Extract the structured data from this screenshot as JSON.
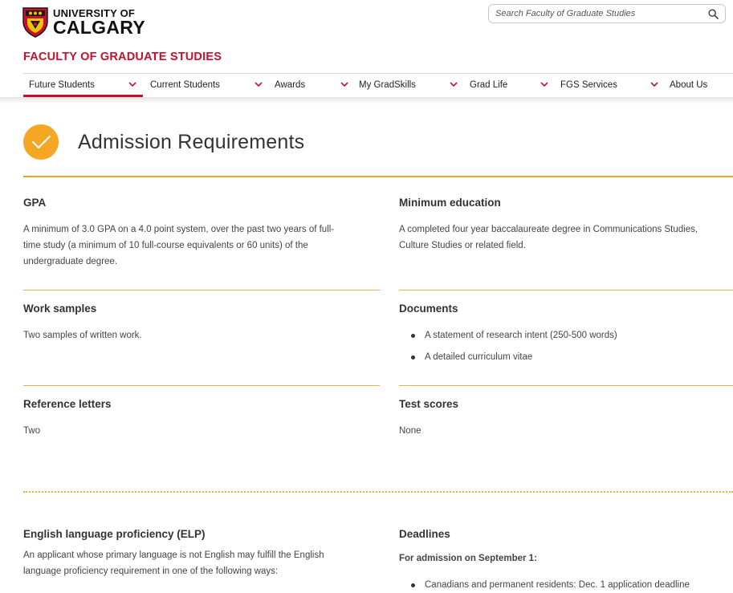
{
  "brand": {
    "university_top": "UNIVERSITY OF",
    "university_bottom": "CALGARY",
    "faculty": "FACULTY OF GRADUATE STUDIES",
    "colors": {
      "red": "#c8102e",
      "gold": "#e8a51e"
    },
    "crest_icon": "university-crest-icon"
  },
  "search": {
    "placeholder": "Search Faculty of Graduate Studies",
    "value": "",
    "icon": "search-icon"
  },
  "nav": {
    "items": [
      {
        "label": "Future Students",
        "active": true
      },
      {
        "label": "Current Students"
      },
      {
        "label": "Awards"
      },
      {
        "label": "My GradSkills"
      },
      {
        "label": "Grad Life"
      },
      {
        "label": "FGS Services"
      },
      {
        "label": "About Us"
      }
    ],
    "chevron_icon": "chevron-down-icon"
  },
  "page": {
    "title": "Admission Requirements",
    "title_icon": "checkmark-icon"
  },
  "requirements": {
    "gpa": {
      "heading": "GPA",
      "lines": [
        "A minimum of 3.0 GPA on a 4.0 point system, over the past two years of full-",
        "time study (a minimum of 10 full-course equivalents or 60 units) of the",
        "undergraduate degree."
      ]
    },
    "education": {
      "heading": "Minimum education",
      "lines": [
        "A completed four year baccalaureate degree in Communications Studies,",
        "Culture Studies or related field."
      ]
    },
    "work_samples": {
      "heading": "Work samples",
      "text": "Two samples of written work."
    },
    "documents": {
      "heading": "Documents",
      "items": [
        "A statement of research intent (250-500 words)",
        "A detailed curriculum vitae"
      ]
    },
    "reference_letters": {
      "heading": "Reference letters",
      "text": "Two"
    },
    "test_scores": {
      "heading": "Test scores",
      "text": "None"
    }
  },
  "elp": {
    "heading": "English language proficiency (ELP)",
    "lines": [
      "An applicant whose primary language is not English may fulfill the English",
      "language proficiency requirement in one of the following ways:"
    ]
  },
  "deadlines": {
    "heading": "Deadlines",
    "subheading": "For admission on September 1:",
    "items": [
      "Canadians and permanent residents: Dec. 1 application deadline"
    ]
  }
}
